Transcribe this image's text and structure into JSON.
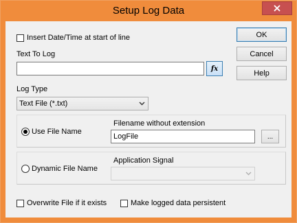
{
  "window": {
    "title": "Setup Log Data"
  },
  "buttons": {
    "ok": "OK",
    "cancel": "Cancel",
    "help": "Help",
    "browse": "...",
    "fx": "fx"
  },
  "insert_datetime": {
    "label": "Insert Date/Time at start of line",
    "checked": false
  },
  "text_to_log": {
    "label": "Text To Log",
    "value": ""
  },
  "log_type": {
    "label": "Log Type",
    "selected": "Text File (*.txt)"
  },
  "use_file_name": {
    "label": "Use File Name",
    "selected": true,
    "field_label": "Filename without extension",
    "value": "LogFile"
  },
  "dynamic_file_name": {
    "label": "Dynamic File Name",
    "selected": false,
    "field_label": "Application Signal",
    "value": ""
  },
  "overwrite": {
    "label": "Overwrite File if it exists",
    "checked": false
  },
  "persistent": {
    "label": "Make logged data persistent",
    "checked": false
  },
  "colors": {
    "titlebar": "#f08c3c",
    "close": "#c75050",
    "face": "#f0f0f0"
  }
}
